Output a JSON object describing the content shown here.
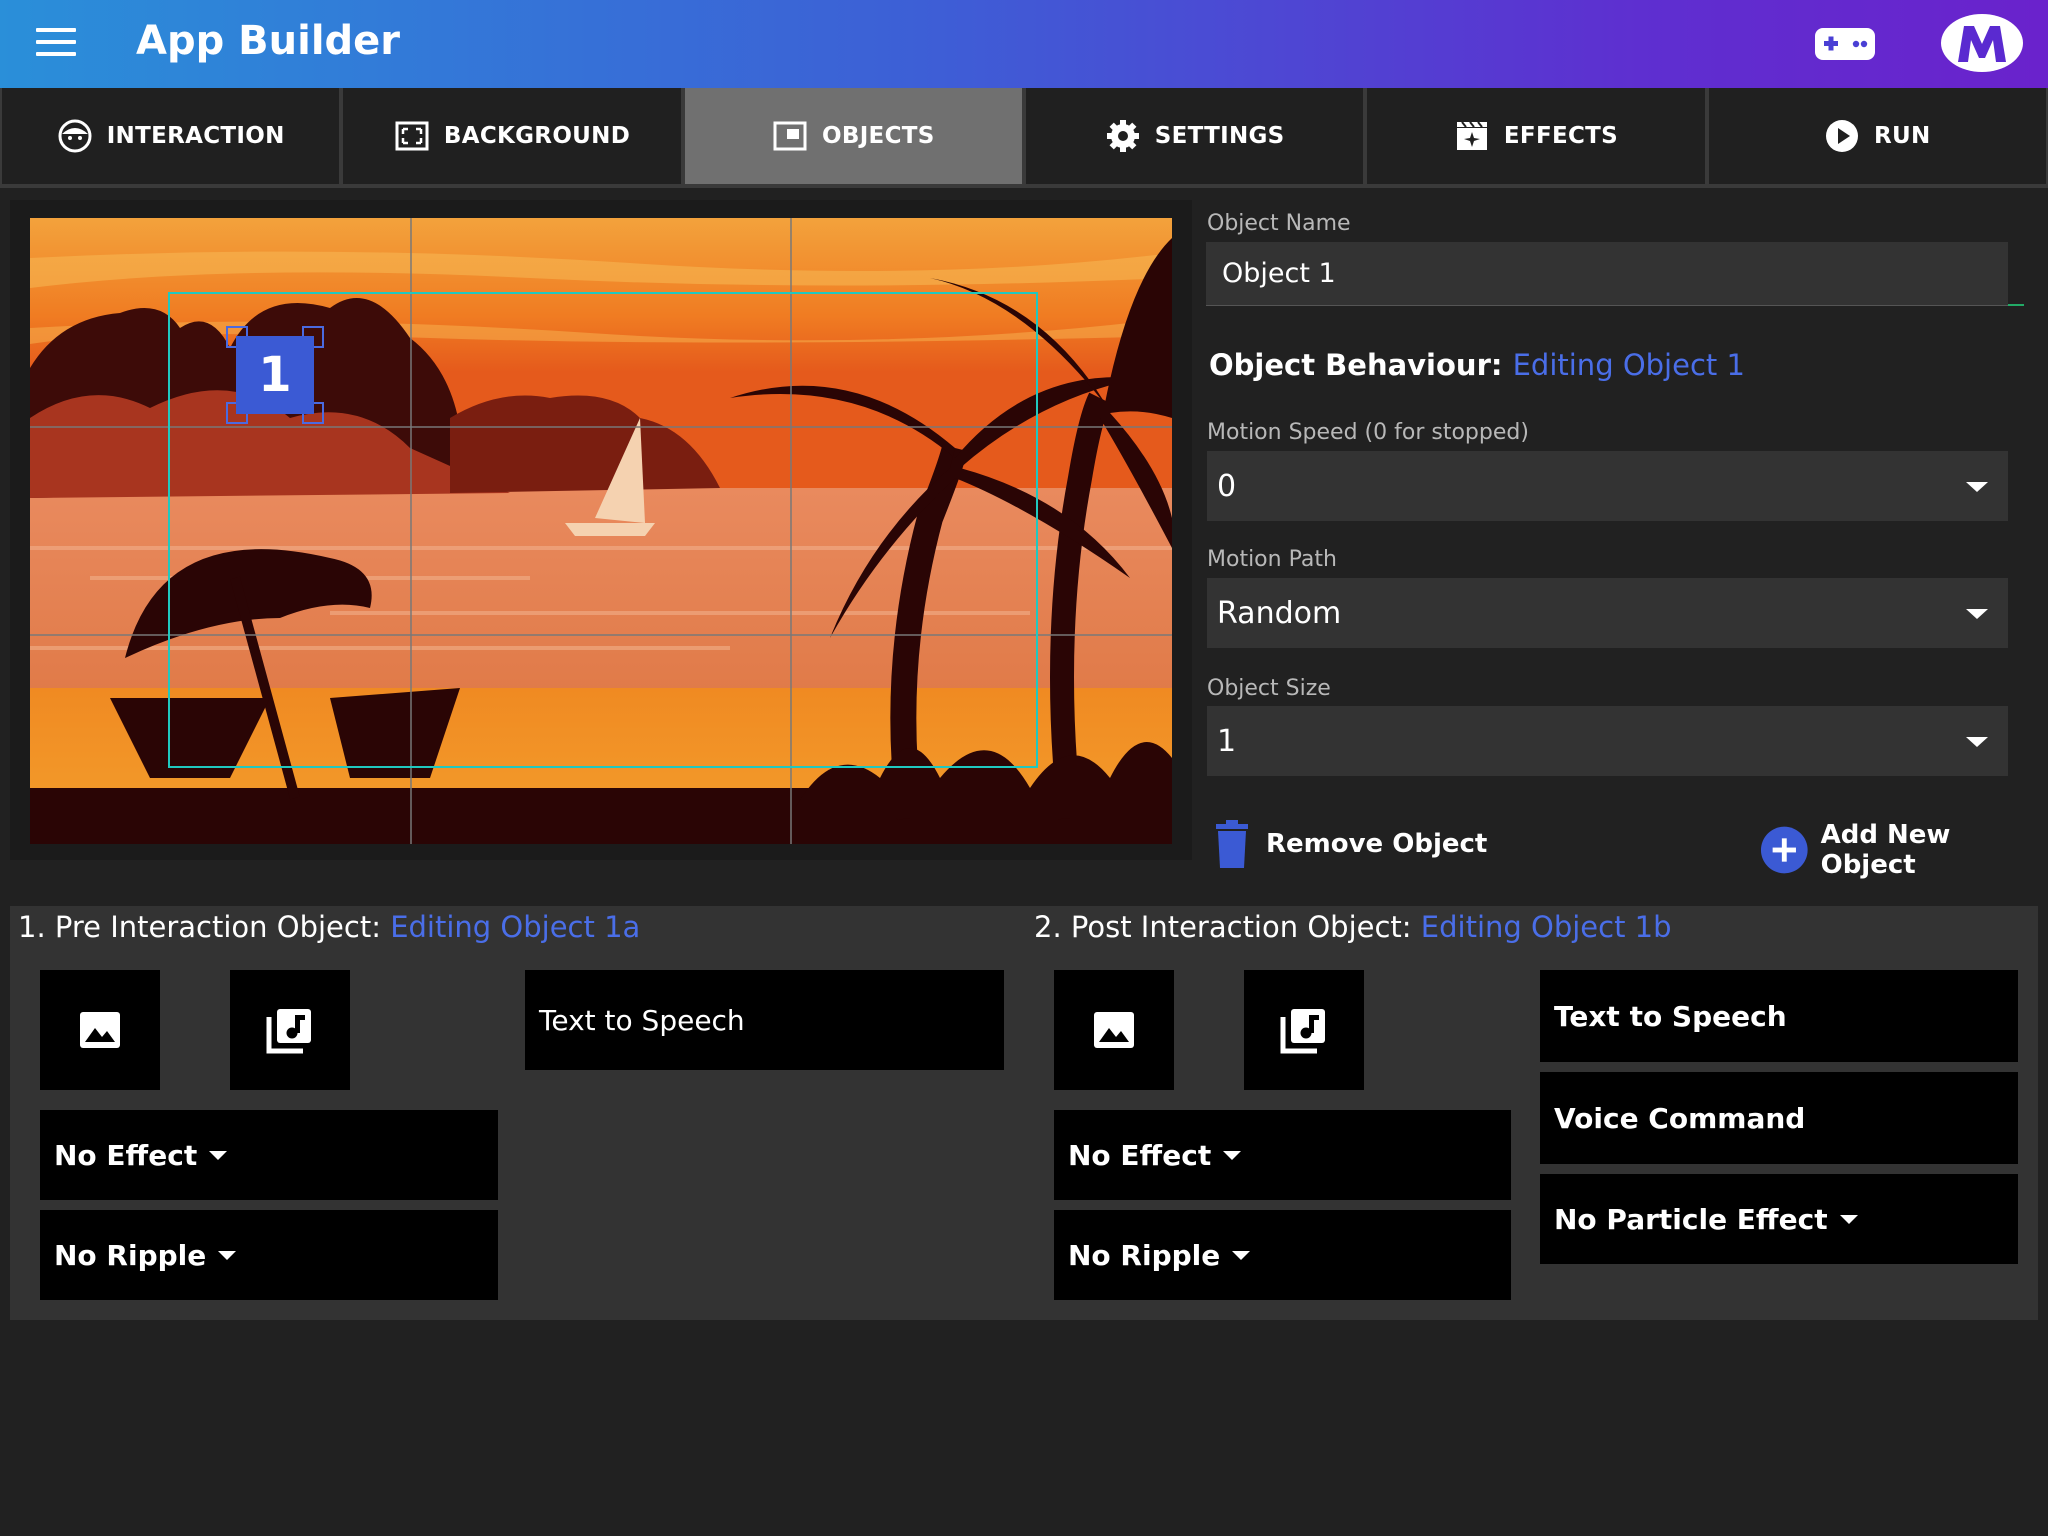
{
  "app": {
    "title": "App Builder"
  },
  "tabs": [
    {
      "label": "INTERACTION",
      "icon": "face-icon",
      "active": false
    },
    {
      "label": "BACKGROUND",
      "icon": "frame-icon",
      "active": false
    },
    {
      "label": "OBJECTS",
      "icon": "picture-in-picture-icon",
      "active": true
    },
    {
      "label": "SETTINGS",
      "icon": "gear-icon",
      "active": false
    },
    {
      "label": "EFFECTS",
      "icon": "movie-sparkle-icon",
      "active": false
    },
    {
      "label": "RUN",
      "icon": "play-circle-icon",
      "active": false
    }
  ],
  "preview": {
    "object_number": "1"
  },
  "object_panel": {
    "name_label": "Object Name",
    "name_value": "Object 1",
    "behaviour_label": "Object Behaviour:",
    "behaviour_editing": "Editing Object 1",
    "speed_label": "Motion Speed (0 for stopped)",
    "speed_value": "0",
    "path_label": "Motion Path",
    "path_value": "Random",
    "size_label": "Object Size",
    "size_value": "1",
    "remove_label": "Remove Object",
    "add_label": "Add New Object"
  },
  "pre": {
    "title": "1. Pre Interaction Object:",
    "editing": "Editing Object 1a",
    "tts": "Text to Speech",
    "effect": "No Effect",
    "ripple": "No Ripple"
  },
  "post": {
    "title": "2. Post Interaction Object:",
    "editing": "Editing Object 1b",
    "tts": "Text to Speech",
    "voice": "Voice Command",
    "effect": "No Effect",
    "ripple": "No Ripple",
    "particle": "No Particle Effect"
  },
  "colors": {
    "accent": "#4a6ee8",
    "active_tab": "#707070",
    "bounds": "#20c8c0",
    "marker": "#3b5ad4"
  }
}
